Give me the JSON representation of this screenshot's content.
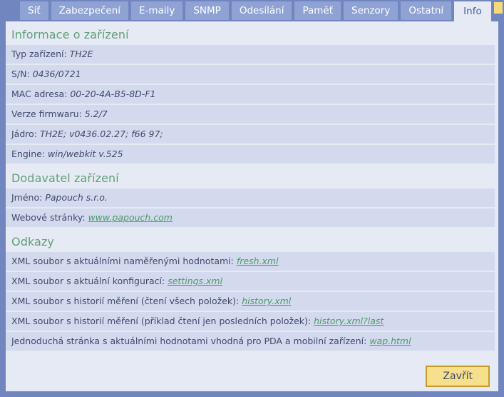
{
  "tabs": [
    {
      "label": "Síť",
      "active": false
    },
    {
      "label": "Zabezpečení",
      "active": false
    },
    {
      "label": "E-maily",
      "active": false
    },
    {
      "label": "SNMP",
      "active": false
    },
    {
      "label": "Odesílání",
      "active": false
    },
    {
      "label": "Paměť",
      "active": false
    },
    {
      "label": "Senzory",
      "active": false
    },
    {
      "label": "Ostatní",
      "active": false
    },
    {
      "label": "Info",
      "active": true
    }
  ],
  "sections": [
    {
      "title": "Informace o zařízení",
      "rows": [
        {
          "label": "Typ zařízení:",
          "value": "TH2E"
        },
        {
          "label": "S/N:",
          "value": "0436/0721"
        },
        {
          "label": "MAC adresa:",
          "value": "00-20-4A-B5-8D-F1"
        },
        {
          "label": "Verze firmwaru:",
          "value": "5.2/7"
        },
        {
          "label": "Jádro:",
          "value": "TH2E; v0436.02.27; f66 97;"
        },
        {
          "label": "Engine:",
          "value": "win/webkit v.525"
        }
      ]
    },
    {
      "title": "Dodavatel zařízení",
      "rows": [
        {
          "label": "Jméno:",
          "value": "Papouch s.r.o."
        },
        {
          "label": "Webové stránky:",
          "link": "www.papouch.com"
        }
      ]
    },
    {
      "title": "Odkazy",
      "rows": [
        {
          "label": "XML soubor s aktuálními naměřenými hodnotami:",
          "link": "fresh.xml"
        },
        {
          "label": "XML soubor s aktuální konfigurací:",
          "link": "settings.xml"
        },
        {
          "label": "XML soubor s historií měření (čtení všech položek):",
          "link": "history.xml"
        },
        {
          "label": "XML soubor s historií měření (příklad čtení jen posledních položek):",
          "link": "history.xml?last"
        },
        {
          "label": "Jednoduchá stránka s aktuálními hodnotami vhodná pro PDA a mobilní zařízení:",
          "link": "wap.html"
        }
      ]
    }
  ],
  "footer": {
    "close_label": "Zavřít"
  },
  "colors": {
    "window_bg": "#7186be",
    "panel_bg": "#e6eaf4",
    "row_bg": "#d3daee",
    "tab_bg": "#8fa2d4",
    "heading": "#62a07a",
    "link": "#4e9b68",
    "text": "#3f4a6b",
    "button_bg": "#f7e08d",
    "button_border": "#c59a28",
    "corner_marker": "#f5d97a"
  }
}
